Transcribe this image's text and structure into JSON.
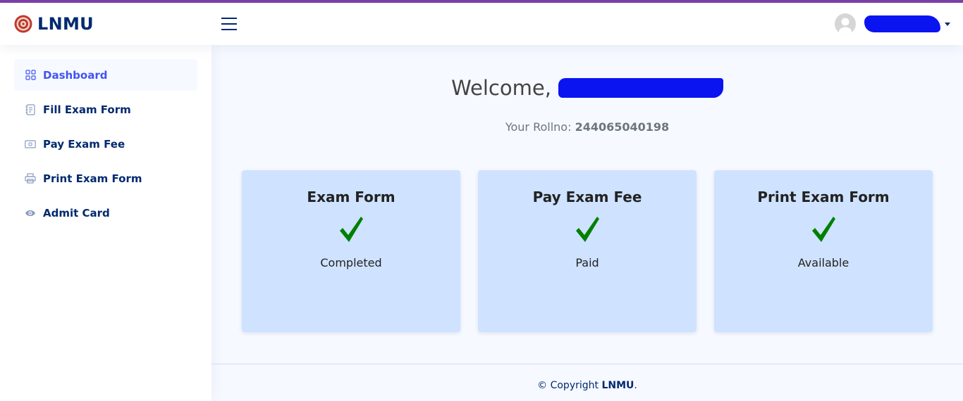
{
  "brand": {
    "name": "LNMU"
  },
  "header": {
    "username": "",
    "icons": {
      "menu": "hamburger-menu-icon",
      "avatar": "user-avatar-icon",
      "caret": "chevron-down-icon"
    }
  },
  "sidebar": {
    "items": [
      {
        "label": "Dashboard",
        "icon": "grid-icon",
        "active": true
      },
      {
        "label": "Fill Exam Form",
        "icon": "journal-text-icon"
      },
      {
        "label": "Pay Exam Fee",
        "icon": "cash-icon"
      },
      {
        "label": "Print Exam Form",
        "icon": "printer-icon"
      },
      {
        "label": "Admit Card",
        "icon": "eye-icon"
      }
    ]
  },
  "main": {
    "welcome_prefix": "Welcome,",
    "welcome_name": "",
    "roll_label": "Your Rollno:",
    "roll_value": "244065040198",
    "cards": [
      {
        "title": "Exam Form",
        "status": "Completed",
        "icon": "checkmark-icon"
      },
      {
        "title": "Pay Exam Fee",
        "status": "Paid",
        "icon": "checkmark-icon"
      },
      {
        "title": "Print Exam Form",
        "status": "Available",
        "icon": "checkmark-icon"
      }
    ]
  },
  "footer": {
    "prefix": "© Copyright",
    "brand": "LNMU",
    "suffix": "."
  },
  "colors": {
    "accent": "#4154f1",
    "navy": "#012970",
    "card_bg": "#cfe2ff",
    "check": "#008000",
    "top_strip": "#7e3fa8",
    "redaction": "#0a14f0"
  }
}
